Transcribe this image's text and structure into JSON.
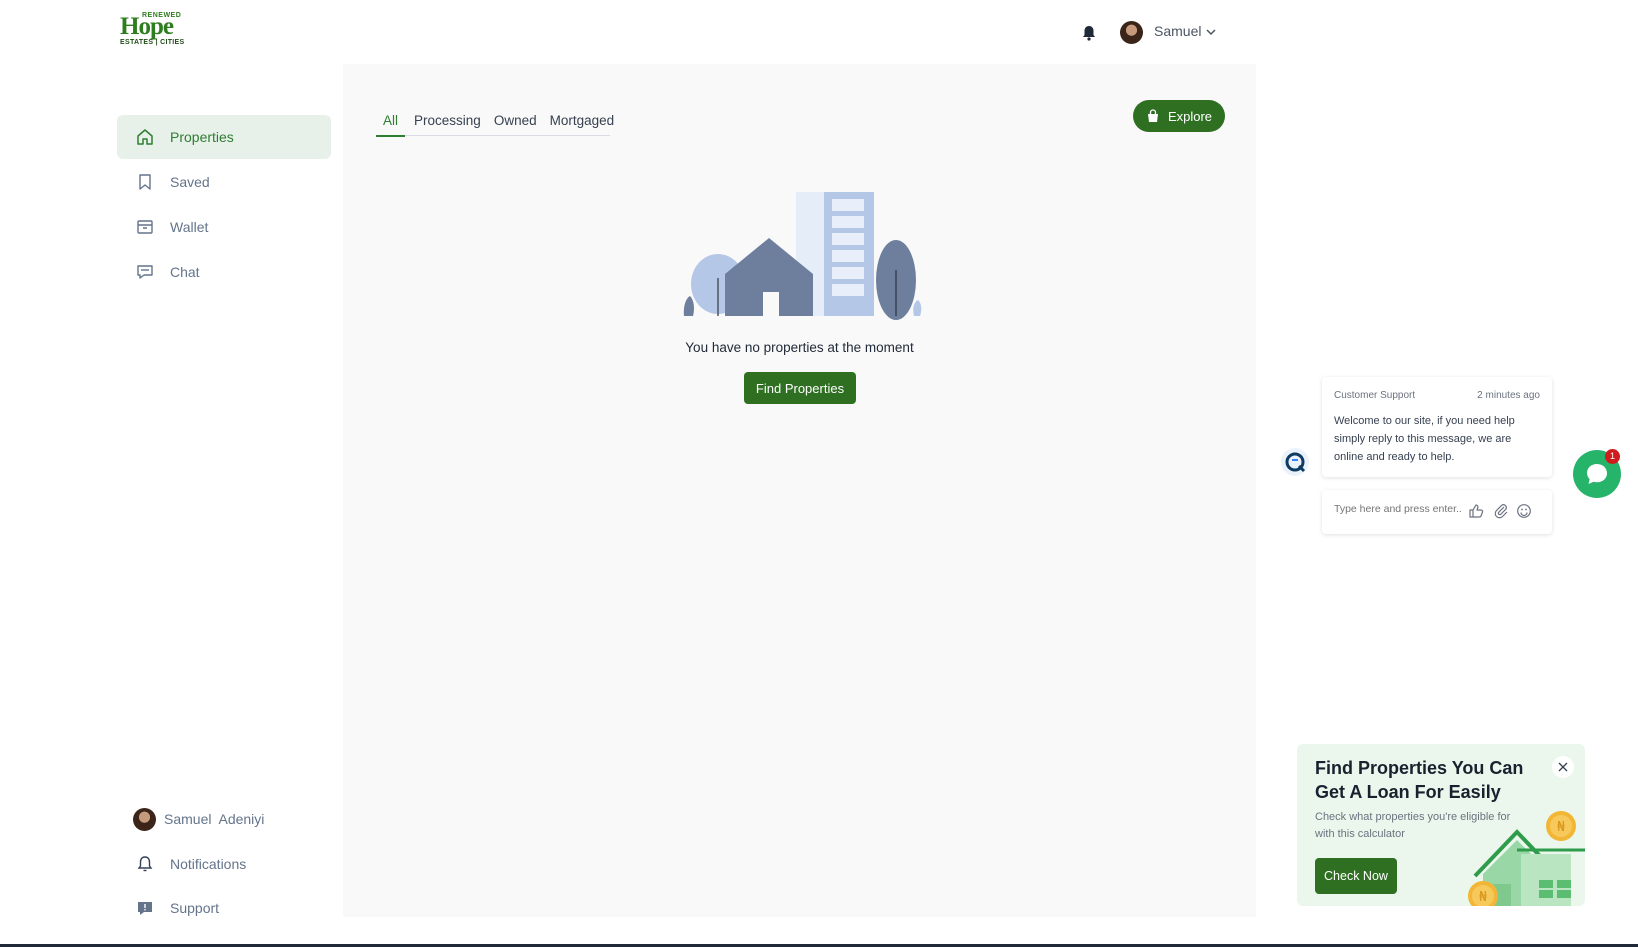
{
  "brand": {
    "logo_main": "Hope",
    "logo_top": "RENEWED",
    "logo_bottom": "ESTATES | CITIES"
  },
  "header": {
    "user_name": "Samuel"
  },
  "sidebar": {
    "items": [
      {
        "label": "Properties",
        "icon": "home-icon",
        "active": true
      },
      {
        "label": "Saved",
        "icon": "bookmark-icon"
      },
      {
        "label": "Wallet",
        "icon": "wallet-icon"
      },
      {
        "label": "Chat",
        "icon": "chat-icon"
      }
    ],
    "bottom": [
      {
        "label": "Samuel  Adeniyi",
        "icon": "avatar"
      },
      {
        "label": "Notifications",
        "icon": "bell-icon"
      },
      {
        "label": "Support",
        "icon": "support-icon"
      }
    ]
  },
  "main": {
    "tabs": [
      {
        "label": "All",
        "active": true
      },
      {
        "label": "Processing"
      },
      {
        "label": "Owned"
      },
      {
        "label": "Mortgaged"
      }
    ],
    "explore_label": "Explore",
    "empty_message": "You have no properties at the moment",
    "find_button": "Find Properties"
  },
  "chat": {
    "sender": "Customer Support",
    "time": "2 minutes ago",
    "message": "Welcome to our site, if you need help simply reply to this message, we are online and ready to help.",
    "input_placeholder": "Type here and press enter..",
    "badge_count": "1"
  },
  "promo": {
    "title": "Find Properties You Can Get A Loan For Easily",
    "description": "Check what properties you're eligible for with this calculator",
    "button": "Check Now"
  },
  "colors": {
    "primary": "#2f6f22",
    "accent": "#2e7d32",
    "active_bg": "#e8f0ea",
    "chat_green": "#26b36a",
    "badge_red": "#d01c1c"
  }
}
